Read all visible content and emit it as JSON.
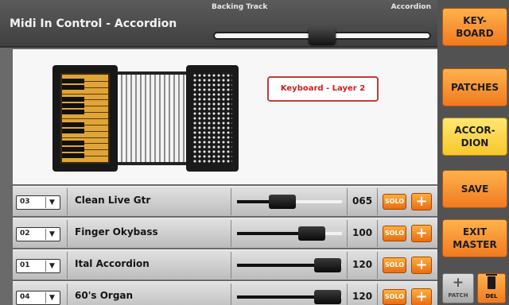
{
  "header": {
    "title": "Midi In Control - Accordion",
    "crossfade_left_label": "Backing Track",
    "crossfade_right_label": "Accordion",
    "crossfade_position": 0.5
  },
  "display": {
    "layer_label": "Keyboard - Layer 2"
  },
  "tracks": [
    {
      "channel": "03",
      "name": "Clean Live Gtr",
      "volume": "065",
      "volume_fraction": 0.51,
      "solo_label": "SOLO",
      "add_label": "+"
    },
    {
      "channel": "02",
      "name": "Finger Okybass",
      "volume": "100",
      "volume_fraction": 0.79,
      "solo_label": "SOLO",
      "add_label": "+"
    },
    {
      "channel": "01",
      "name": "Ital Accordion",
      "volume": "120",
      "volume_fraction": 0.94,
      "solo_label": "SOLO",
      "add_label": "+"
    },
    {
      "channel": "04",
      "name": "60's Organ",
      "volume": "120",
      "volume_fraction": 0.94,
      "solo_label": "SOLO",
      "add_label": "+"
    }
  ],
  "side_panel": {
    "keyboard": "KEY-\nBOARD",
    "patches": "PATCHES",
    "accordion": "ACCOR-\nDION",
    "save": "SAVE",
    "exit_master": "EXIT\nMASTER",
    "patch_icon": "+",
    "patch_label": "PATCH",
    "del_label": "DEL"
  },
  "colors": {
    "accent_orange": "#f07a20",
    "active_yellow": "#f8c72a",
    "layer_red": "#d21c1c"
  }
}
